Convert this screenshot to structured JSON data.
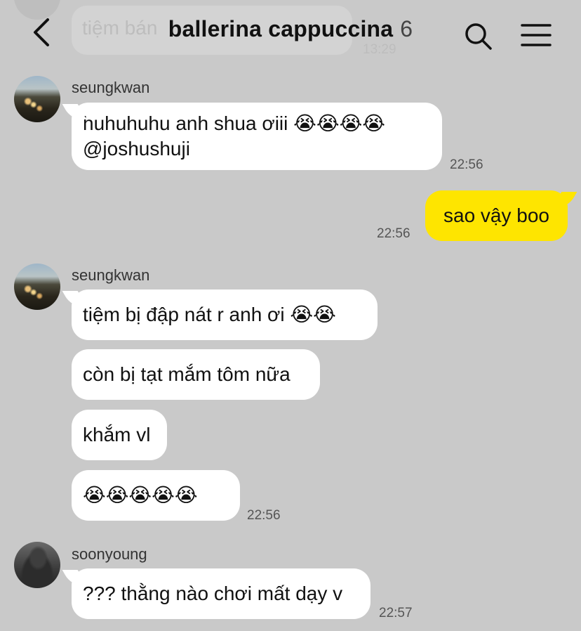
{
  "header": {
    "title": "ballerina cappuccina",
    "member_count": "6"
  },
  "previous_message": {
    "text": "tiệm bán",
    "time": "13:29"
  },
  "messages": [
    {
      "sender": "seungkwan",
      "bubbles": [
        {
          "lines": [
            "huhuhuhu anh shua ơiii 😭😭😭😭",
            "@joshushuji"
          ]
        }
      ],
      "time": "22:56"
    },
    {
      "sender": "me",
      "bubbles": [
        {
          "lines": [
            "sao vậy boo"
          ]
        }
      ],
      "time": "22:56"
    },
    {
      "sender": "seungkwan",
      "bubbles": [
        {
          "lines": [
            "tiệm bị đập nát r anh ơi 😭😭"
          ]
        },
        {
          "lines": [
            "còn bị tạt mắm tôm nữa"
          ]
        },
        {
          "lines": [
            "khắm vl"
          ]
        },
        {
          "lines": [
            "😭😭😭😭😭"
          ]
        }
      ],
      "time": "22:56"
    },
    {
      "sender": "soonyoung",
      "bubbles": [
        {
          "lines": [
            "??? thằng nào chơi mất dạy v"
          ]
        }
      ],
      "time": "22:57"
    }
  ],
  "icons": [
    "back-icon",
    "search-icon",
    "menu-icon"
  ],
  "colors": {
    "background": "#c9c9c9",
    "my_bubble": "#fee500",
    "their_bubble": "#ffffff"
  }
}
